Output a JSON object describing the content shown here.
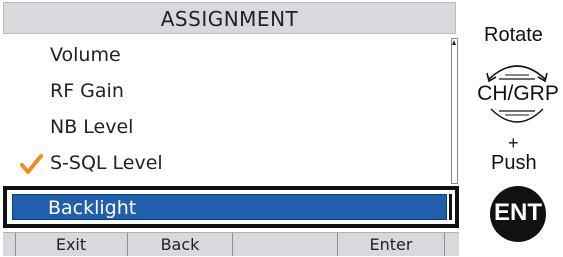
{
  "screen": {
    "title": "ASSIGNMENT",
    "items": [
      {
        "label": "Volume",
        "checked": false
      },
      {
        "label": "RF Gain",
        "checked": false
      },
      {
        "label": "NB Level",
        "checked": false
      },
      {
        "label": "S-SQL Level",
        "checked": true
      }
    ],
    "selected_item": "Backlight",
    "softkeys": [
      "Exit",
      "Back",
      "",
      "Enter"
    ]
  },
  "controls": {
    "rotate_label": "Rotate",
    "dial_label": "CH/GRP",
    "plus_label": "+",
    "push_label": "Push",
    "ent_label": "ENT"
  },
  "colors": {
    "highlight": "#1f5fae",
    "check": "#f28a1c",
    "bar": "#d7d9dd"
  }
}
